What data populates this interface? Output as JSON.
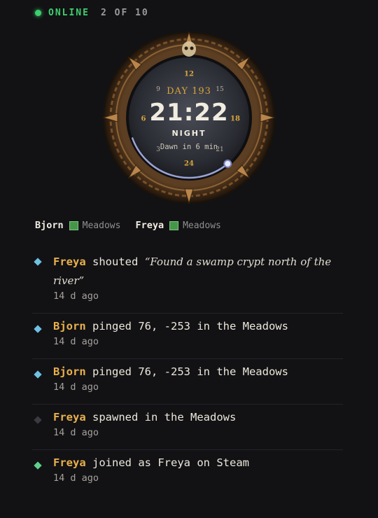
{
  "status": {
    "state": "ONLINE",
    "count": "2 OF 10",
    "color": "#3ecf6d"
  },
  "clock": {
    "day": "DAY 193",
    "time": "21:22",
    "phase": "NIGHT",
    "dawn": "Dawn in 6 min",
    "hours": {
      "top": "12",
      "left": "6",
      "right": "18",
      "bottom": "24",
      "tl": "9",
      "tr": "15",
      "br": "21",
      "bl": "3"
    },
    "progress": 0.77
  },
  "players": [
    {
      "name": "Bjorn",
      "biome": "Meadows"
    },
    {
      "name": "Freya",
      "biome": "Meadows"
    }
  ],
  "feed": [
    {
      "icon": "info-diamond-icon",
      "color": "#6ec1e4",
      "who": "Freya",
      "action": "shouted",
      "quote": "“Found a swamp crypt north of the river”",
      "ago": "14 d ago"
    },
    {
      "icon": "info-diamond-icon",
      "color": "#6ec1e4",
      "who": "Bjorn",
      "action": "pinged 76, -253 in the Meadows",
      "ago": "14 d ago"
    },
    {
      "icon": "info-diamond-icon",
      "color": "#6ec1e4",
      "who": "Bjorn",
      "action": "pinged 76, -253 in the Meadows",
      "ago": "14 d ago"
    },
    {
      "icon": "muted-diamond-icon",
      "color": "#3a3a40",
      "who": "Freya",
      "action": "spawned in the Meadows",
      "ago": "14 d ago"
    },
    {
      "icon": "join-diamond-icon",
      "color": "#5fd08a",
      "who": "Freya",
      "action": "joined as Freya on Steam",
      "ago": "14 d ago"
    }
  ]
}
